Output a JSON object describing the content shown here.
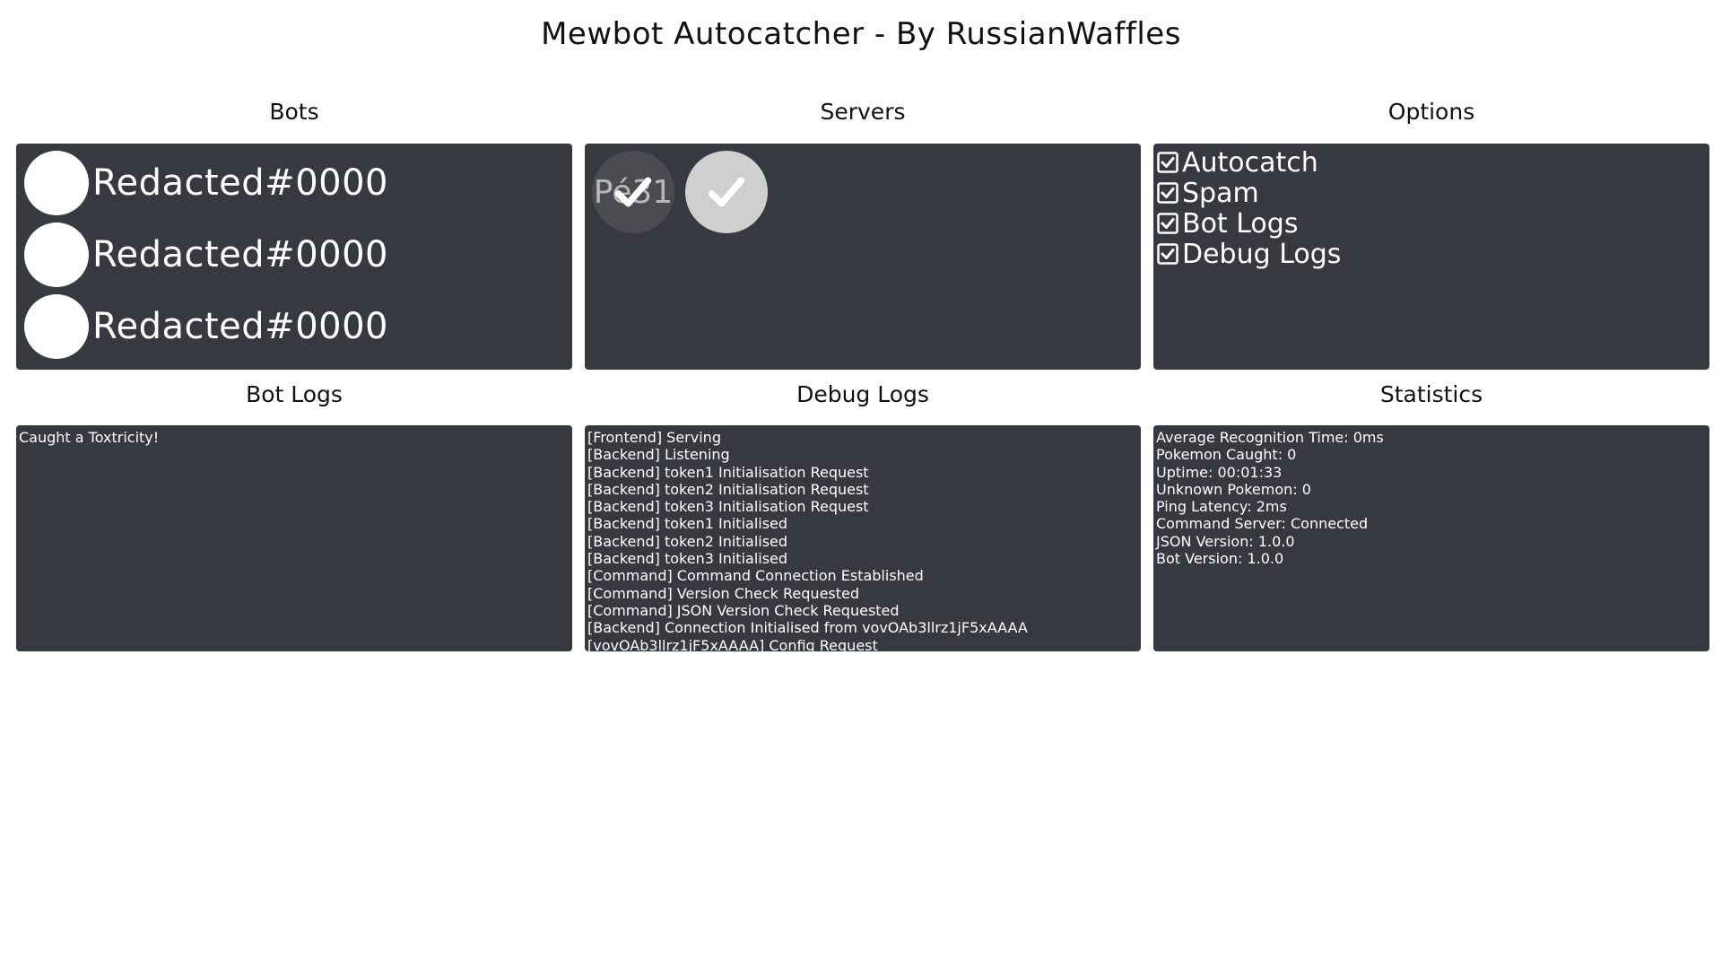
{
  "title": "Mewbot Autocatcher - By RussianWaffles",
  "sections": {
    "bots": "Bots",
    "servers": "Servers",
    "options": "Options",
    "bot_logs": "Bot Logs",
    "debug_logs": "Debug Logs",
    "statistics": "Statistics"
  },
  "bots": [
    {
      "name": "Redacted#0000"
    },
    {
      "name": "Redacted#0000"
    },
    {
      "name": "Redacted#0000"
    }
  ],
  "servers": [
    {
      "abbr": "Pé31",
      "enabled": true,
      "icon": "check-icon"
    },
    {
      "abbr": "",
      "enabled": true,
      "icon": "check-icon"
    }
  ],
  "options": [
    {
      "label": "Autocatch",
      "checked": true
    },
    {
      "label": "Spam",
      "checked": true
    },
    {
      "label": "Bot Logs",
      "checked": true
    },
    {
      "label": "Debug Logs",
      "checked": true
    }
  ],
  "bot_logs": [
    "Caught a Toxtricity!"
  ],
  "debug_logs": [
    "[Frontend] Serving",
    "[Backend] Listening",
    "[Backend] token1 Initialisation Request",
    "[Backend] token2 Initialisation Request",
    "[Backend] token3 Initialisation Request",
    "[Backend] token1 Initialised",
    "[Backend] token2 Initialised",
    "[Backend] token3 Initialised",
    "[Command] Command Connection Established",
    "[Command] Version Check Requested",
    "[Command] JSON Version Check Requested",
    "[Backend] Connection Initialised from vovOAb3llrz1jF5xAAAA",
    "[vovOAb3llrz1jF5xAAAA] Config Request"
  ],
  "statistics": [
    "Average Recognition Time: 0ms",
    "Pokemon Caught: 0",
    "Uptime: 00:01:33",
    "Unknown Pokemon: 0",
    "Ping Latency: 2ms",
    "Command Server: Connected",
    "JSON Version: 1.0.0",
    "Bot Version: 1.0.0"
  ],
  "colors": {
    "panel": "#363940",
    "page": "#ffffff"
  }
}
